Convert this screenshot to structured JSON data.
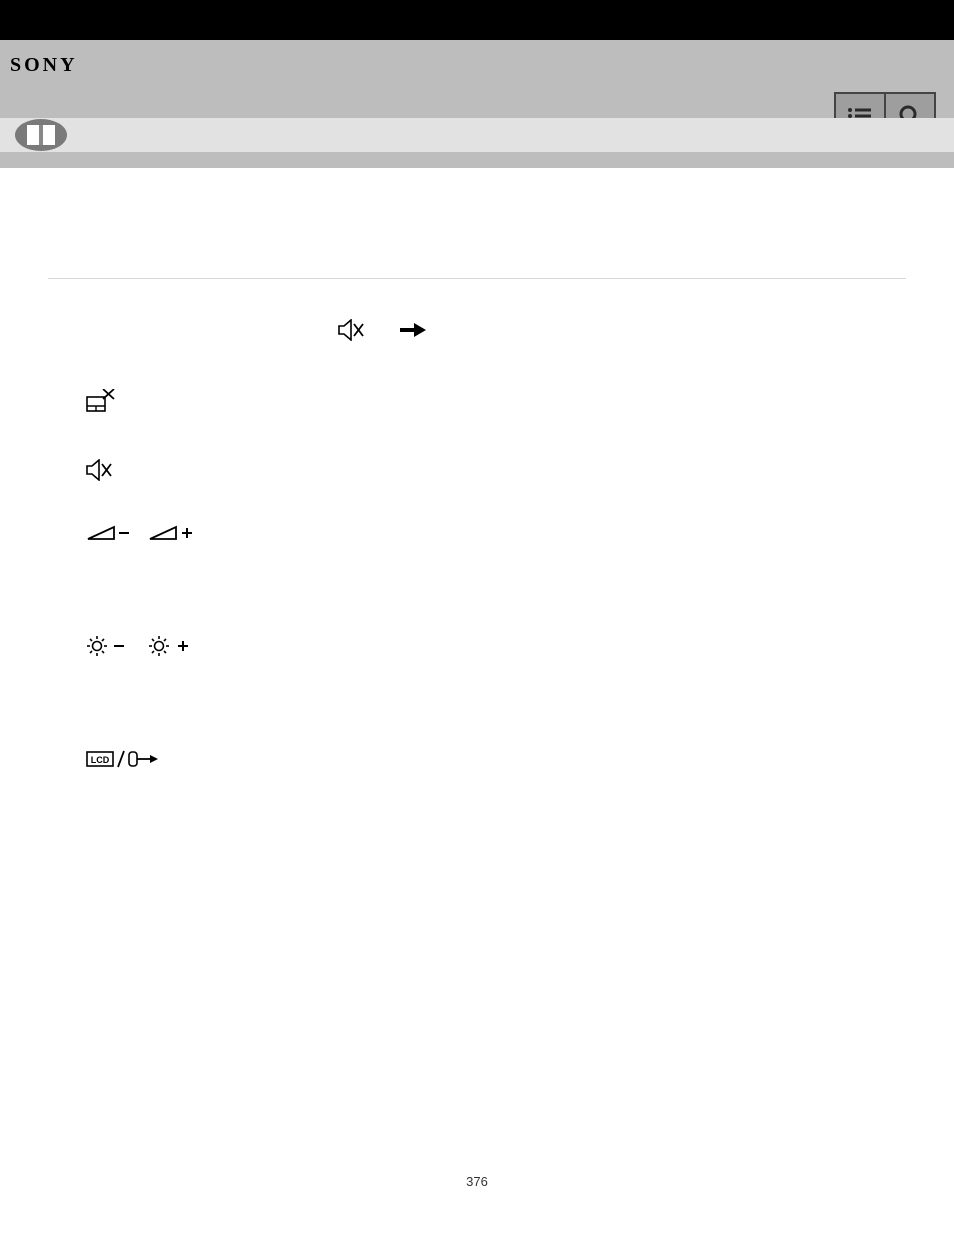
{
  "brand": "SONY",
  "page_number": "376"
}
